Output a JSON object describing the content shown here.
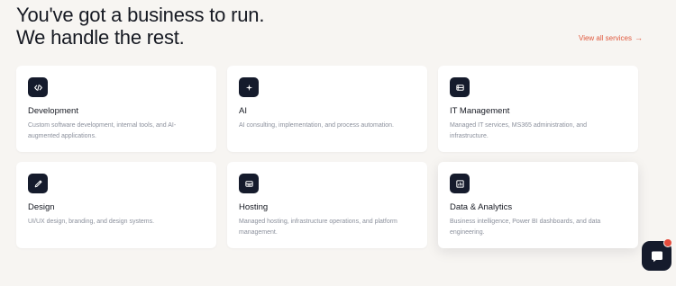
{
  "hero": {
    "line1": "You've got a business to run.",
    "line2": "We handle the rest."
  },
  "view_all": {
    "label": "View all services",
    "arrow": "→"
  },
  "services": [
    {
      "icon": "code-icon",
      "title": "Development",
      "description": "Custom software development, internal tools, and AI-augmented applications."
    },
    {
      "icon": "sparkle-icon",
      "title": "AI",
      "description": "AI consulting, implementation, and process automation."
    },
    {
      "icon": "server-icon",
      "title": "IT Management",
      "description": "Managed IT services, MS365 administration, and infrastructure."
    },
    {
      "icon": "pen-icon",
      "title": "Design",
      "description": "UI/UX design, branding, and design systems."
    },
    {
      "icon": "hosting-icon",
      "title": "Hosting",
      "description": "Managed hosting, infrastructure operations, and platform management."
    },
    {
      "icon": "bar-chart-icon",
      "title": "Data & Analytics",
      "description": "Business intelligence, Power BI dashboards, and data engineering."
    }
  ],
  "chat": {
    "icon": "chat-icon",
    "badge_icon": "notification-dot-icon"
  },
  "colors": {
    "background": "#f7f5f2",
    "card": "#ffffff",
    "icon_tile": "#151b2c",
    "accent": "#e0593e",
    "muted_text": "#8b909c",
    "notification": "#e54b3c"
  }
}
